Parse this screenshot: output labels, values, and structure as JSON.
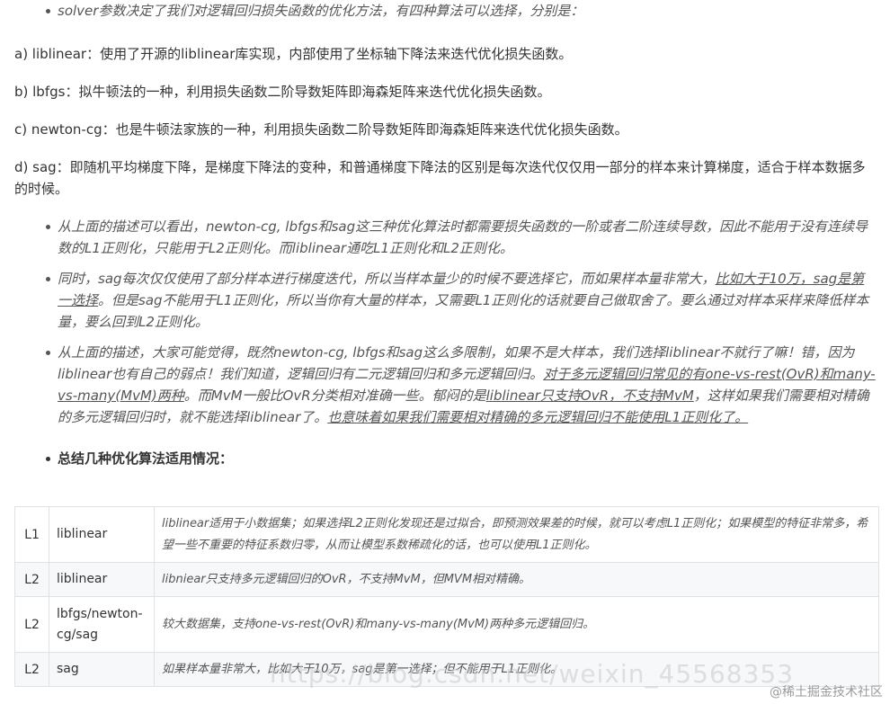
{
  "bullet_top": "solver参数决定了我们对逻辑回归损失函数的优化方法，有四种算法可以选择，分别是：",
  "algorithms": {
    "a": "a) liblinear：使用了开源的liblinear库实现，内部使用了坐标轴下降法来迭代优化损失函数。",
    "b": "b) lbfgs：拟牛顿法的一种，利用损失函数二阶导数矩阵即海森矩阵来迭代优化损失函数。",
    "c": "c) newton-cg：也是牛顿法家族的一种，利用损失函数二阶导数矩阵即海森矩阵来迭代优化损失函数。",
    "d": "d) sag：即随机平均梯度下降，是梯度下降法的变种，和普通梯度下降法的区别是每次迭代仅仅用一部分的样本来计算梯度，适合于样本数据多的时候。"
  },
  "notes": {
    "n1": "从上面的描述可以看出，newton-cg, lbfgs和sag这三种优化算法时都需要损失函数的一阶或者二阶连续导数，因此不能用于没有连续导数的L1正则化，只能用于L2正则化。而liblinear通吃L1正则化和L2正则化。",
    "n2_a": "同时，sag每次仅仅使用了部分样本进行梯度迭代，所以当样本量少的时候不要选择它，而如果样本量非常大，",
    "n2_u": "比如大于10万，sag是第一选择",
    "n2_b": "。但是sag不能用于L1正则化，所以当你有大量的样本，又需要L1正则化的话就要自己做取舍了。要么通过对样本采样来降低样本量，要么回到L2正则化。",
    "n3_a": "从上面的描述，大家可能觉得，既然newton-cg, lbfgs和sag这么多限制，如果不是大样本，我们选择liblinear不就行了嘛！错，因为liblinear也有自己的弱点！我们知道，逻辑回归有二元逻辑回归和多元逻辑回归。",
    "n3_u1": "对于多元逻辑回归常见的有one-vs-rest(OvR)和many-vs-many(MvM)两种",
    "n3_b": "。而MvM一般比OvR分类相对准确一些。郁闷的是",
    "n3_u2": "liblinear只支持OvR，不支持MvM",
    "n3_c": "，这样如果我们需要相对精确的多元逻辑回归时，就不能选择liblinear了。",
    "n3_u3": "也意味着如果我们需要相对精确的多元逻辑回归不能使用L1正则化了。"
  },
  "summary_title": "总结几种优化算法适用情况：",
  "table": [
    {
      "reg": "L1",
      "solver": "liblinear",
      "desc": "liblinear适用于小数据集；如果选择L2正则化发现还是过拟合，即预测效果差的时候，就可以考虑L1正则化；如果模型的特征非常多，希望一些不重要的特征系数归零，从而让模型系数稀疏化的话，也可以使用L1正则化。"
    },
    {
      "reg": "L2",
      "solver": "liblinear",
      "desc": "libniear只支持多元逻辑回归的OvR，不支持MvM，但MVM相对精确。"
    },
    {
      "reg": "L2",
      "solver": "lbfgs/newton-cg/sag",
      "desc": "较大数据集，支持one-vs-rest(OvR)和many-vs-many(MvM)两种多元逻辑回归。"
    },
    {
      "reg": "L2",
      "solver": "sag",
      "desc": "如果样本量非常大，比如大于10万，sag是第一选择；但不能用于L1正则化。"
    }
  ],
  "watermark_url": "https://blog.csdn.net/weixin_45568353",
  "watermark_site": "@稀土掘金技术社区"
}
